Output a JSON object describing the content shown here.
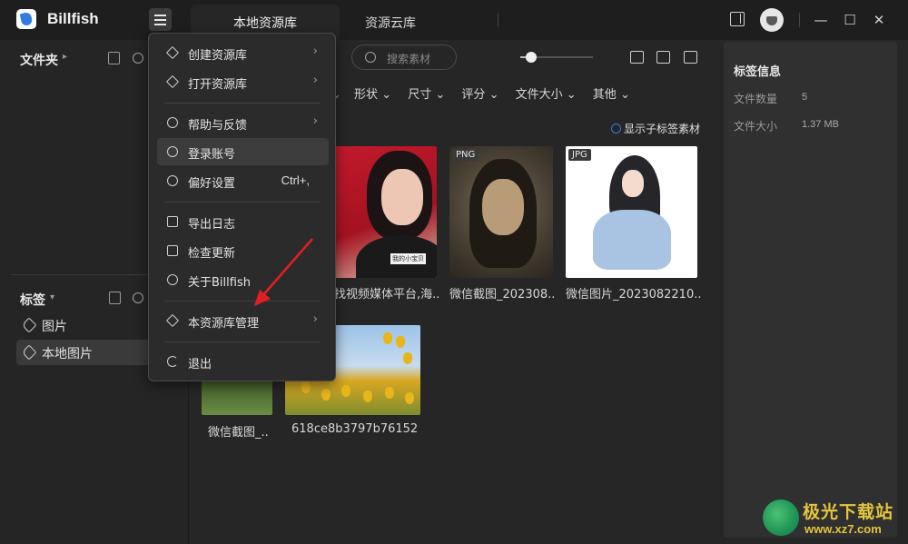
{
  "app": {
    "name": "Billfish"
  },
  "tabs": [
    {
      "label": "本地资源库"
    },
    {
      "label": "资源云库"
    }
  ],
  "window": {
    "minimize": "—",
    "maximize": "☐",
    "close": "✕"
  },
  "sidebar": {
    "folders_title": "文件夹",
    "tags_title": "标签",
    "tag_items": [
      {
        "label": "图片"
      },
      {
        "label": "本地图片"
      }
    ]
  },
  "toolbar": {
    "search_placeholder": "搜索素材",
    "zoom_level": 0.15,
    "filters": [
      "形状",
      "尺寸",
      "评分",
      "文件大小",
      "其他"
    ],
    "show_sub_tags": "显示子标签素材"
  },
  "grid": {
    "items": [
      {
        "caption": "找视频媒体平台,海..",
        "badge": "",
        "watermark_text": "我的小宝贝"
      },
      {
        "caption": "微信截图_202308..",
        "badge": "PNG"
      },
      {
        "caption": "微信图片_2023082210..",
        "badge": "JPG"
      },
      {
        "caption": "微信截图_..",
        "badge": ""
      },
      {
        "caption": "618ce8b3797b76152",
        "badge": ""
      }
    ]
  },
  "info_panel": {
    "title": "标签信息",
    "rows": [
      {
        "label": "文件数量",
        "value": "5"
      },
      {
        "label": "文件大小",
        "value": "1.37 MB"
      }
    ]
  },
  "menu": {
    "items": [
      {
        "label": "创建资源库",
        "icon": "cube-icon",
        "arrow": "›"
      },
      {
        "label": "打开资源库",
        "icon": "cube-icon",
        "arrow": "›"
      },
      {
        "label": "帮助与反馈",
        "icon": "help-icon",
        "arrow": "›"
      },
      {
        "label": "登录账号",
        "icon": "user-icon"
      },
      {
        "label": "偏好设置",
        "icon": "gear-icon",
        "shortcut": "Ctrl+,"
      },
      {
        "label": "导出日志",
        "icon": "calendar-icon"
      },
      {
        "label": "检查更新",
        "icon": "update-icon"
      },
      {
        "label": "关于Billfish",
        "icon": "info-icon"
      },
      {
        "label": "本资源库管理",
        "icon": "cube-icon",
        "arrow": "›"
      },
      {
        "label": "退出",
        "icon": "exit-icon"
      }
    ]
  },
  "watermark": {
    "text": "极光下载站",
    "url": "www.xz7.com"
  },
  "colors": {
    "background": "#262626",
    "titlebar": "#1e1e1e",
    "accent": "#2f7de1",
    "annotation_arrow": "#e02020"
  }
}
